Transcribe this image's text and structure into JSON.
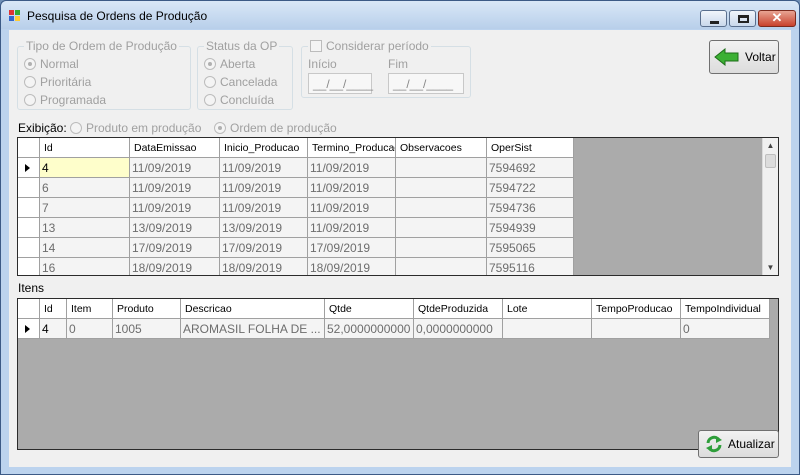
{
  "window": {
    "title": "Pesquisa de Ordens de Produção"
  },
  "filters": {
    "tipo": {
      "title": "Tipo de Ordem de Produção",
      "options": [
        "Normal",
        "Prioritária",
        "Programada"
      ],
      "selected": 0
    },
    "status": {
      "title": "Status da OP",
      "options": [
        "Aberta",
        "Cancelada",
        "Concluída"
      ],
      "selected": 0
    },
    "periodo": {
      "checkbox_label": "Considerar período",
      "inicio_label": "Início",
      "fim_label": "Fim",
      "inicio_value": "__/__/____",
      "fim_value": "__/__/____"
    }
  },
  "buttons": {
    "voltar": "Voltar",
    "atualizar": "Atualizar"
  },
  "exibicao": {
    "label": "Exibição:",
    "options": [
      "Produto em produção",
      "Ordem de produção"
    ],
    "selected": 1
  },
  "orders_grid": {
    "columns": [
      "Id",
      "DataEmissao",
      "Inicio_Producao",
      "Termino_Producao",
      "Observacoes",
      "OperSist"
    ],
    "rows": [
      [
        "4",
        "11/09/2019",
        "11/09/2019",
        "11/09/2019",
        "",
        "7594692"
      ],
      [
        "6",
        "11/09/2019",
        "11/09/2019",
        "11/09/2019",
        "",
        "7594722"
      ],
      [
        "7",
        "11/09/2019",
        "11/09/2019",
        "11/09/2019",
        "",
        "7594736"
      ],
      [
        "13",
        "13/09/2019",
        "13/09/2019",
        "11/09/2019",
        "",
        "7594939"
      ],
      [
        "14",
        "17/09/2019",
        "17/09/2019",
        "17/09/2019",
        "",
        "7595065"
      ],
      [
        "16",
        "18/09/2019",
        "18/09/2019",
        "18/09/2019",
        "",
        "7595116"
      ]
    ],
    "current_row": 0
  },
  "itens_label": "Itens",
  "items_grid": {
    "columns": [
      "Id",
      "Item",
      "Produto",
      "Descricao",
      "Qtde",
      "QtdeProduzida",
      "Lote",
      "TempoProducao",
      "TempoIndividual"
    ],
    "rows": [
      [
        "4",
        "0",
        "1005",
        "AROMASIL FOLHA DE ...",
        "52,0000000000",
        "0,0000000000",
        "",
        "",
        "0"
      ]
    ],
    "current_row": 0
  },
  "colors": {
    "window_frame": "#bcd3ee",
    "grid_bg": "#ababab",
    "selected_cell": "#fefecb",
    "close_button": "#c8412c"
  }
}
